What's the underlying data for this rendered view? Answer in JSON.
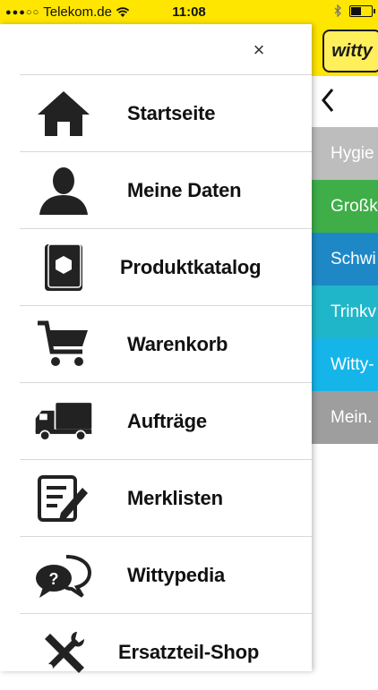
{
  "status_bar": {
    "signal": "●●●○○",
    "carrier": "Telekom.de",
    "time": "11:08"
  },
  "drawer": {
    "close_icon": "×",
    "items": [
      {
        "label": "Startseite",
        "icon": "home-icon"
      },
      {
        "label": "Meine Daten",
        "icon": "user-icon"
      },
      {
        "label": "Produktkatalog",
        "icon": "catalog-icon"
      },
      {
        "label": "Warenkorb",
        "icon": "cart-icon"
      },
      {
        "label": "Aufträge",
        "icon": "truck-icon"
      },
      {
        "label": "Merklisten",
        "icon": "notepad-pen-icon"
      },
      {
        "label": "Wittypedia",
        "icon": "speech-bubbles-icon"
      },
      {
        "label": "Ersatzteil-Shop",
        "icon": "tools-icon"
      }
    ]
  },
  "background": {
    "logo_text": "witty",
    "categories": [
      {
        "label": "Hygie",
        "color": "#bdbdbd"
      },
      {
        "label": "Großk",
        "color": "#3fae49"
      },
      {
        "label": "Schwi",
        "color": "#1e88c7"
      },
      {
        "label": "Trinkv",
        "color": "#1fb6c9"
      },
      {
        "label": "Witty-",
        "color": "#15b5ea"
      },
      {
        "label": "Mein.",
        "color": "#9e9e9e"
      }
    ]
  },
  "colors": {
    "accent_yellow": "#ffe600"
  }
}
